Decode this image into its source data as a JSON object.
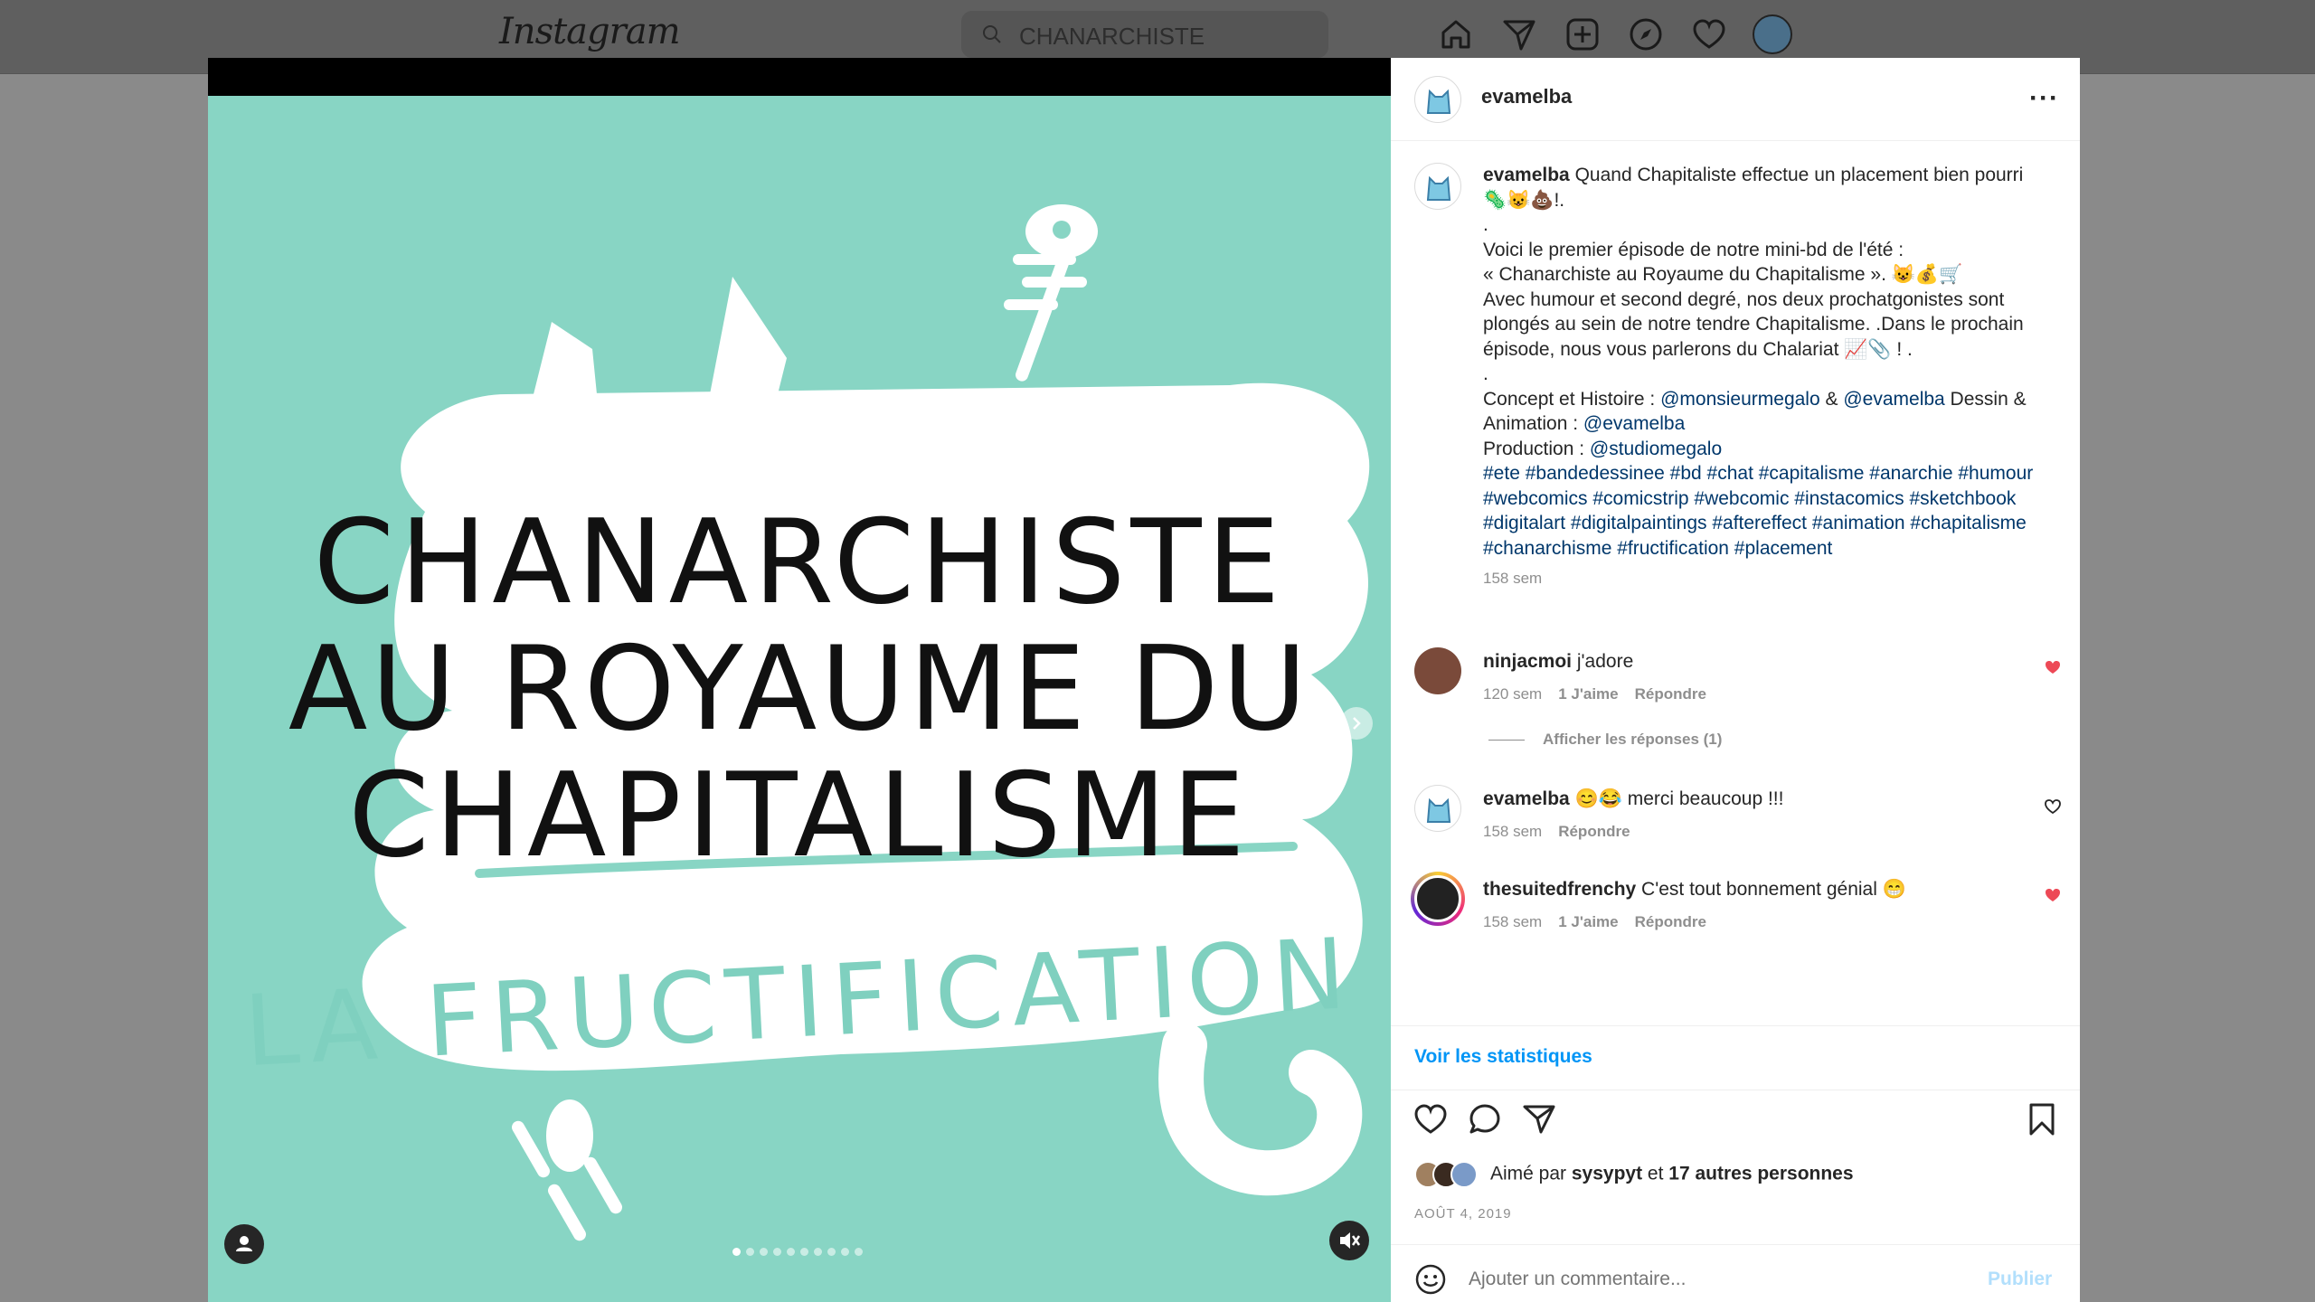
{
  "nav": {
    "logo": "Instagram",
    "search_value": "CHANARCHISTE",
    "icons": [
      "home-icon",
      "direct-icon",
      "new-post-icon",
      "explore-icon",
      "activity-icon",
      "profile-avatar"
    ]
  },
  "media": {
    "title_lines": [
      "CHANARCHISTE",
      "AU ROYAUME DU",
      "CHAPITALISME"
    ],
    "subtitle": "LA FRUCTIFICATION",
    "carousel_count": 10,
    "carousel_active": 1,
    "bg_color": "#88d5c4",
    "accent_color": "#7fd0bf"
  },
  "post": {
    "username": "evamelba",
    "caption": {
      "user": "evamelba",
      "line1": " Quand Chapitaliste effectue un placement bien pourri 🦠😺💩!.",
      "dot1": ".",
      "line2": "Voici le premier épisode de notre mini-bd de l'été :",
      "line3": "« Chanarchiste au Royaume du Chapitalisme ». 😺💰🛒",
      "line4": "Avec humour et second degré, nos deux prochatgonistes sont plongés au sein de notre tendre Chapitalisme. .Dans le prochain épisode, nous vous parlerons du Chalariat 📈📎 ! .",
      "dot2": ".",
      "credits_a": "Concept et Histoire : ",
      "credit_1": "@monsieurmegalo",
      "credits_amp": " & ",
      "credit_2": "@evamelba",
      "credits_b": " Dessin & Animation : ",
      "credit_3": "@evamelba",
      "production": "Production : ",
      "credit_4": "@studiomegalo",
      "hashtags": "#ete #bandedessinee #bd #chat #capitalisme #anarchie #humour #webcomics #comicstrip #webcomic #instacomics #sketchbook #digitalart #digitalpaintings #aftereffect #animation #chapitalisme #chanarchisme #fructification #placement",
      "time": "158 sem"
    },
    "comments": [
      {
        "user": "ninjacmoi",
        "text": "j'adore",
        "time": "120 sem",
        "likes": "1 J'aime",
        "reply": "Répondre",
        "liked": true
      },
      {
        "user": "evamelba",
        "text": "😊😂 merci beaucoup !!!",
        "time": "158 sem",
        "likes": "",
        "reply": "Répondre",
        "liked": false
      },
      {
        "user": "thesuitedfrenchy",
        "text": "C'est tout bonnement génial 😁",
        "time": "158 sem",
        "likes": "1 J'aime",
        "reply": "Répondre",
        "liked": true
      }
    ],
    "show_replies": "Afficher les réponses (1)",
    "stats_link": "Voir les statistiques",
    "liked_by_prefix": "Aimé par ",
    "liked_by_user": "sysypyt",
    "liked_by_mid": " et ",
    "liked_by_others": "17 autres personnes",
    "date": "AOÛT 4, 2019",
    "comment_placeholder": "Ajouter un commentaire...",
    "publish": "Publier",
    "heart_color": "#ed4956",
    "link_color": "#00376b",
    "blue_color": "#0095f6"
  }
}
